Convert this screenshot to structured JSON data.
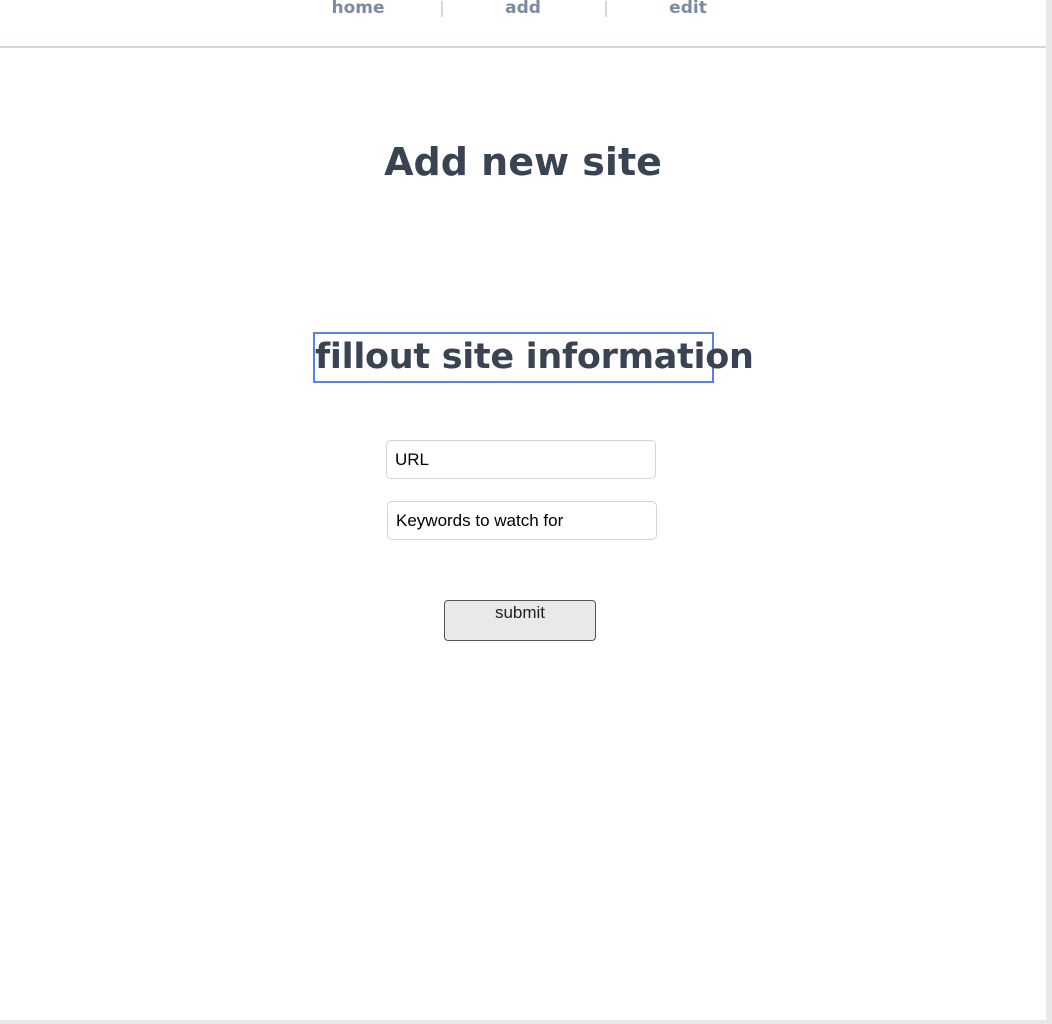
{
  "nav": {
    "items": [
      {
        "label": "home"
      },
      {
        "label": "add"
      },
      {
        "label": "edit"
      }
    ]
  },
  "page_title": "Add new site",
  "form": {
    "heading": "fillout site information",
    "url_placeholder": "URL",
    "keywords_placeholder": "Keywords to watch for",
    "submit_label": "submit"
  },
  "colors": {
    "heading": "#3a4352",
    "nav": "#7b8aa0",
    "focus_outline": "#5a7fe6"
  }
}
